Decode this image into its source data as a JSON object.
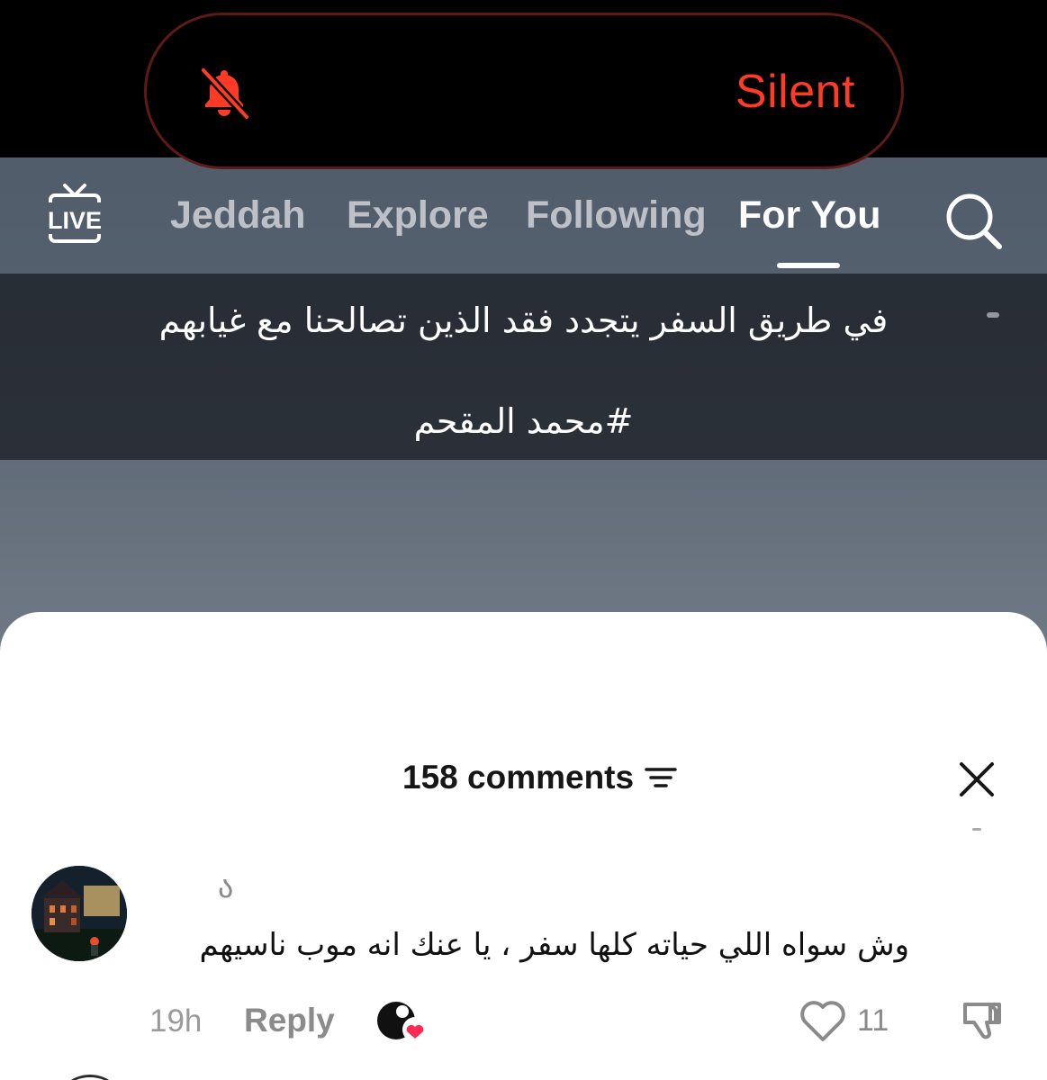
{
  "status": {
    "silent_label": "Silent",
    "silent_color": "#ff3b26",
    "icon": "bell-slash-icon"
  },
  "top_nav": {
    "live_icon": "live-tv-icon",
    "live_label": "LIVE",
    "tabs": [
      {
        "label": "Jeddah",
        "active": false
      },
      {
        "label": "Explore",
        "active": false
      },
      {
        "label": "Following",
        "active": false
      },
      {
        "label": "For You",
        "active": true
      }
    ],
    "search_icon": "search-icon"
  },
  "video": {
    "caption_line1": "في طريق السفر يتجدد فقد الذين تصالحنا مع غيابهم",
    "caption_line2": "#محمد المقحم"
  },
  "comments_panel": {
    "title": "158 comments",
    "filter_icon": "filter-icon",
    "close_icon": "close-icon",
    "comments": [
      {
        "username": "ა",
        "text": "وش سواه اللي حياته كلها سفر ، يا عنك انه موب ناسيهم",
        "time": "19h",
        "reply_label": "Reply",
        "like_count": "11",
        "creator_liked": true,
        "heart_color": "#fe2c55"
      }
    ]
  }
}
